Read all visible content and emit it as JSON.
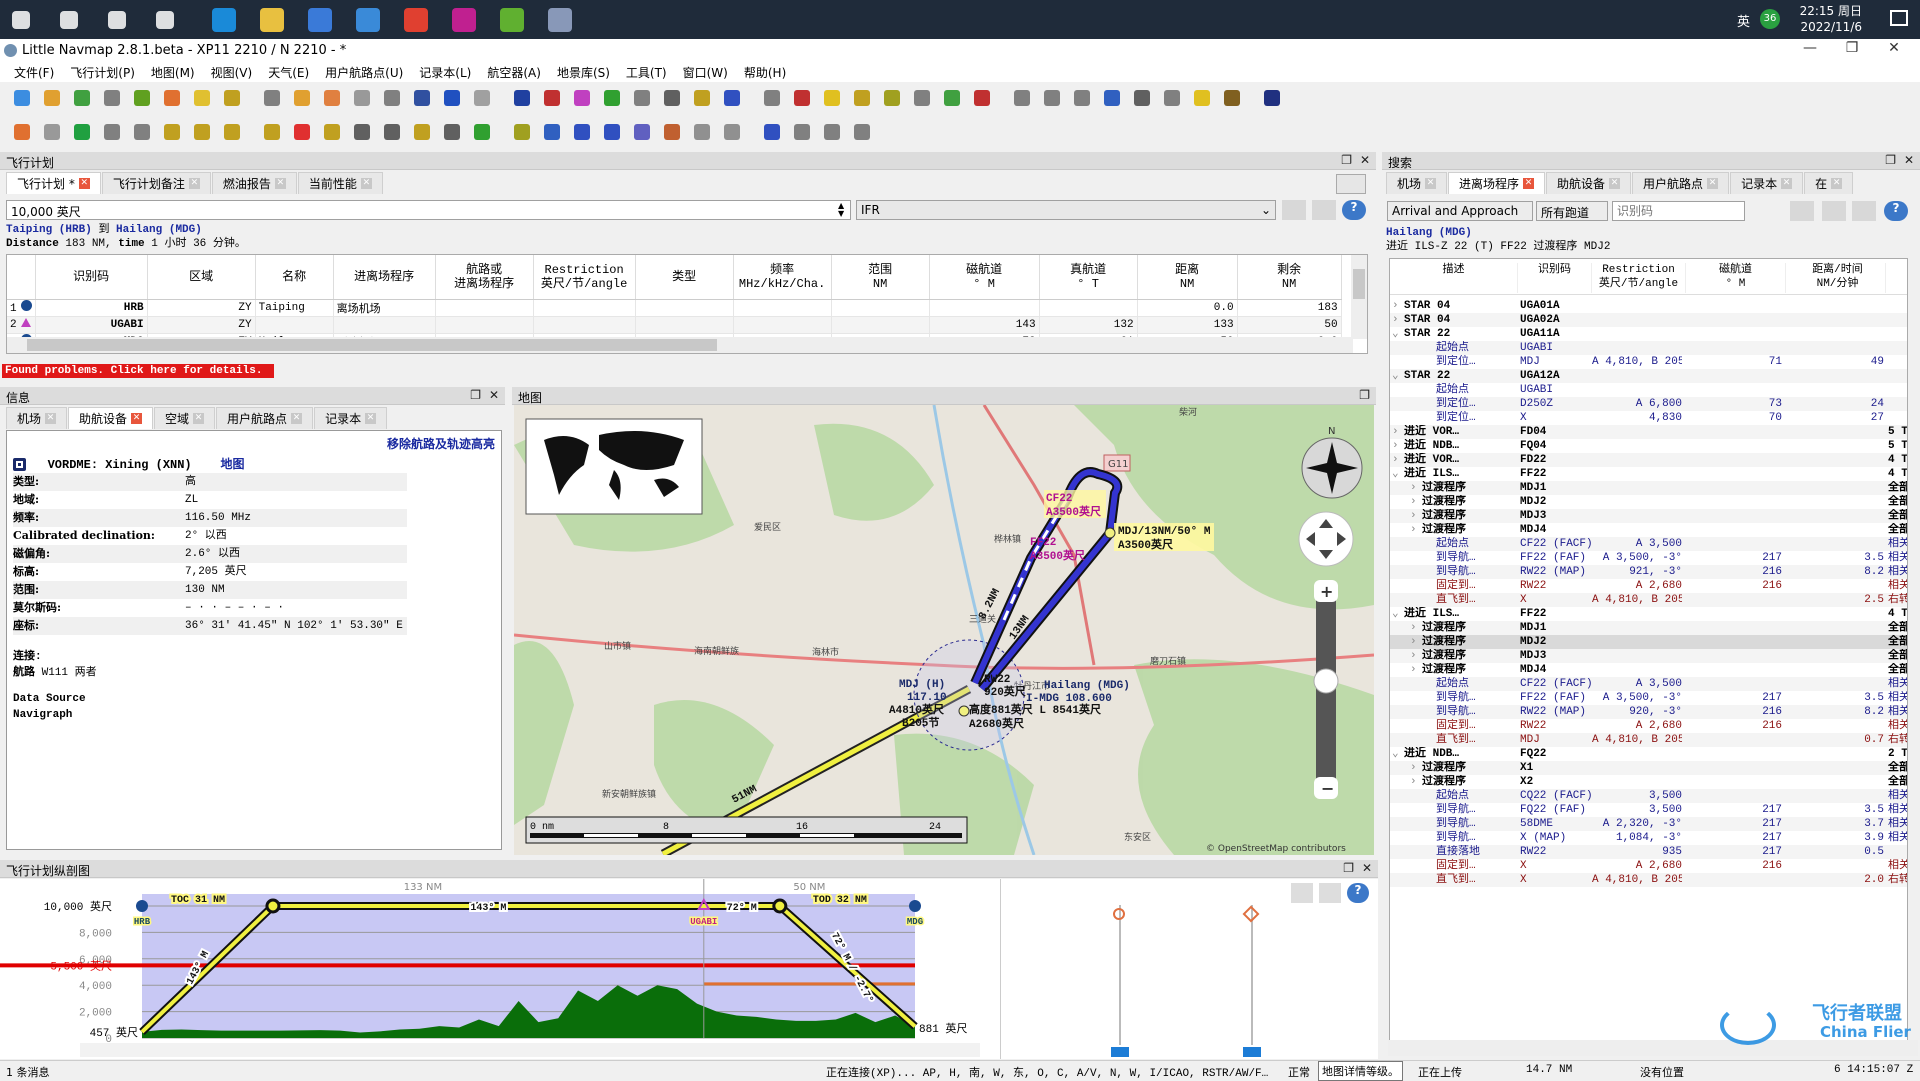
{
  "taskbar": {
    "tray_lang": "英",
    "tray_badge": "36",
    "time": "22:15 周日",
    "date": "2022/11/6",
    "apps": [
      "start-icon",
      "search-icon",
      "cortana-icon",
      "taskview-icon",
      "edge-icon",
      "explorer-icon",
      "store-icon",
      "mail-icon",
      "chrome-icon",
      "app-icon",
      "app-green-icon",
      "littlenavmap-icon"
    ]
  },
  "window": {
    "title": "Little Navmap 2.8.1.beta - XP11 2210 / N 2210 - *"
  },
  "menu": [
    "文件(F)",
    "飞行计划(P)",
    "地图(M)",
    "视图(V)",
    "天气(E)",
    "用户航路点(U)",
    "记录本(L)",
    "航空器(A)",
    "地景库(S)",
    "工具(T)",
    "窗口(W)",
    "帮助(H)"
  ],
  "toolbar": {
    "row1": [
      [
        "new-icon",
        "#3c8de0"
      ],
      [
        "open-icon",
        "#e0a030"
      ],
      [
        "save-icon",
        "#40a040"
      ],
      [
        "save-as-icon",
        "#808080"
      ],
      [
        "reload-icon",
        "#60a020"
      ],
      [
        "home-icon",
        "#e07030"
      ],
      [
        "add-icon",
        "#e0c030"
      ],
      [
        "route-icon",
        "#c0a020"
      ],
      [
        "clear-icon",
        "#808080"
      ],
      [
        "upload-icon",
        "#e0a030"
      ],
      [
        "back-icon",
        "#e08040"
      ],
      [
        "forward-icon",
        "#999999"
      ],
      [
        "search-map-icon",
        "#808080"
      ],
      [
        "globe-icon",
        "#3050a0"
      ],
      [
        "vor-icon",
        "#2050c0"
      ],
      [
        "ndb-icon",
        "#a0a0a0"
      ],
      [
        "ils-icon",
        "#2040a0"
      ],
      [
        "weather-icon",
        "#c03030"
      ],
      [
        "waypoint-icon",
        "#c040c0"
      ],
      [
        "airway-icon",
        "#30a030"
      ],
      [
        "pencil-icon",
        "#808080"
      ],
      [
        "compass-icon",
        "#606060"
      ],
      [
        "v-icon",
        "#c0a020"
      ],
      [
        "j-icon",
        "#3050c0"
      ],
      [
        "t-icon",
        "#808080"
      ],
      [
        "target-icon",
        "#c03030"
      ],
      [
        "star-icon",
        "#e0c020"
      ],
      [
        "route-line-icon",
        "#c0a020"
      ],
      [
        "leaf-icon",
        "#a0a020"
      ],
      [
        "aircraft-icon",
        "#808080"
      ],
      [
        "aircraft-green-icon",
        "#40a040"
      ],
      [
        "compass-red-icon",
        "#c03030"
      ],
      [
        "plane-icon",
        "#808080"
      ],
      [
        "plane2-icon",
        "#808080"
      ],
      [
        "plane3-icon",
        "#808080"
      ],
      [
        "grid-icon",
        "#3060c0"
      ],
      [
        "circle-icon",
        "#606060"
      ],
      [
        "calc-icon",
        "#808080"
      ],
      [
        "sun-icon",
        "#e0c020"
      ],
      [
        "wind-icon",
        "#806020"
      ],
      [
        "sphere-icon",
        "#203080"
      ]
    ],
    "row2": [
      [
        "undo-icon",
        "#e07030"
      ],
      [
        "redo-icon",
        "#999999"
      ],
      [
        "go-icon",
        "#20a040"
      ],
      [
        "edit-icon",
        "#808080"
      ],
      [
        "edit2-icon",
        "#808080"
      ],
      [
        "select-icon",
        "#c0a020"
      ],
      [
        "add-wp-icon",
        "#c0a020"
      ],
      [
        "move-icon",
        "#c0a020"
      ],
      [
        "move2-icon",
        "#c0a020"
      ],
      [
        "delete-icon",
        "#e03030"
      ],
      [
        "pin-icon",
        "#c0a020"
      ],
      [
        "fit-icon",
        "#606060"
      ],
      [
        "zoom-icon",
        "#606060"
      ],
      [
        "route-fit-icon",
        "#c0a020"
      ],
      [
        "italic-icon",
        "#606060"
      ],
      [
        "terrain-icon",
        "#30a030"
      ],
      [
        "map-icon",
        "#a0a020"
      ],
      [
        "help-map-icon",
        "#3060c0"
      ],
      [
        "nav1-icon",
        "#3050c0"
      ],
      [
        "nav2-icon",
        "#3050c0"
      ],
      [
        "nav3-icon",
        "#6060c0"
      ],
      [
        "nav4-icon",
        "#c06030"
      ],
      [
        "nav5-icon",
        "#909090"
      ],
      [
        "nav6-icon",
        "#909090"
      ],
      [
        "nav7-icon",
        "#3050c0"
      ],
      [
        "doc-icon",
        "#808080"
      ],
      [
        "db-icon",
        "#808080"
      ],
      [
        "gear-icon",
        "#808080"
      ]
    ]
  },
  "flightplan": {
    "dock_title": "飞行计划",
    "tabs": [
      "飞行计划 *",
      "飞行计划备注",
      "燃油报告",
      "当前性能"
    ],
    "altitude": "10,000 英尺",
    "type": "IFR",
    "from": "Taiping (HRB)",
    "to_word": "到",
    "to": "Hailang (MDG)",
    "distance_label": "Distance",
    "distance": "183 NM,",
    "time_label": "time",
    "time": "1 小时 36 分钟。",
    "columns": [
      "",
      "识别码",
      "区域",
      "名称",
      "进离场程序",
      "航路或\n进离场程序",
      "Restriction\n英尺/节/angle",
      "类型",
      "频率\nMHz/kHz/Cha.",
      "范围\nNM",
      "磁航道\n° M",
      "真航道\n° T",
      "距离\nNM",
      "剩余\nNM"
    ],
    "rows": [
      [
        "1",
        "HRB",
        "ZY",
        "Taiping",
        "离场机场",
        "",
        "",
        "",
        "",
        "",
        "",
        "",
        "0.0",
        "183"
      ],
      [
        "2",
        "UGABI",
        "ZY",
        "",
        "",
        "",
        "",
        "",
        "",
        "",
        "143",
        "132",
        "133",
        "50"
      ],
      [
        "3",
        "MDG",
        "ZY",
        "Hailang",
        "到达机场",
        "",
        "",
        "",
        "",
        "",
        "72",
        "61",
        "50",
        "0.0"
      ]
    ],
    "row_icons": [
      "airport-icon",
      "waypoint-icon",
      "airport-icon"
    ],
    "problem": "Found problems. Click here for details."
  },
  "info": {
    "dock_title": "信息",
    "tabs": [
      "机场",
      "助航设备",
      "空域",
      "用户航路点",
      "记录本"
    ],
    "remove_link": "移除航路及轨迹高亮",
    "title": "VORDME: Xining (XNN)",
    "map_link": "地图",
    "rows": [
      [
        "类型:",
        "高"
      ],
      [
        "地域:",
        "ZL"
      ],
      [
        "频率:",
        "116.50 MHz"
      ],
      [
        "Calibrated declination:",
        "2° 以西"
      ],
      [
        "磁偏角:",
        "2.6° 以西"
      ],
      [
        "标高:",
        "7,205 英尺"
      ],
      [
        "范围:",
        "130 NM"
      ],
      [
        "莫尔斯码:",
        "– · · –   – ·   – ·"
      ],
      [
        "座标:",
        "36° 31′ 41.45″ N 102° 1′ 53.30″ E"
      ]
    ],
    "connections_label": "连接:",
    "airway_label": "航路",
    "airway_value": "W111 两者",
    "source_label": "Data Source",
    "source_value": "Navigraph"
  },
  "map": {
    "dock_title": "地图",
    "towns": [
      [
        "柴河",
        "665",
        "-2"
      ],
      [
        "爱民区",
        "240",
        "113"
      ],
      [
        "桦林镇",
        "480",
        "125"
      ],
      [
        "三道关",
        "455",
        "205"
      ],
      [
        "海林市",
        "298",
        "238"
      ],
      [
        "海南朝鲜族",
        "180",
        "237"
      ],
      [
        "山市镇",
        "90",
        "232"
      ],
      [
        "牡丹江市",
        "500",
        "272"
      ],
      [
        "磨刀石镇",
        "636",
        "247"
      ],
      [
        "新安朝鲜族镇",
        "88",
        "380"
      ],
      [
        "温春镇",
        "380",
        "412"
      ],
      [
        "东安区",
        "610",
        "423"
      ]
    ],
    "road": "G11",
    "labels": {
      "cf22": "CF22",
      "cf22_alt": "A3500英尺",
      "ff22": "FF22",
      "ff22_alt": "A3500英尺",
      "mdj13": "MDJ/13NM/50° M",
      "mdj13_alt": "A3500英尺",
      "rw22": "RW22",
      "rw22_alt": "920英尺",
      "mdg": "Hailang (MDG)",
      "freq": "I-MDG 108.600",
      "mdj": "MDJ (H)",
      "mdj_freq": "117.10",
      "mdj_alt": "A4810英尺",
      "mdj_spd": "B205节",
      "alt2680": "A2680英尺",
      "elev": "高度881英尺 L 8541英尺",
      "leg1": "8.2NM",
      "leg2": "13NM",
      "leg3": "51NM"
    },
    "scale": [
      "0 nm",
      "8",
      "16",
      "24"
    ],
    "attribution": "© OpenStreetMap contributors",
    "compass_n": "N"
  },
  "search": {
    "dock_title": "搜索",
    "tabs": [
      "机场",
      "进离场程序",
      "助航设备",
      "用户航路点",
      "记录本",
      "在"
    ],
    "filter": "Arrival and Approach",
    "runway": "所有跑道",
    "ident_placeholder": "识别码",
    "airport": "Hailang (MDG)",
    "selected": "进近 ILS-Z 22 (T) FF22 过渡程序 MDJ2",
    "columns": [
      "描述",
      "识别码",
      "Restriction\n英尺/节/angle",
      "磁航道\n° M",
      "距离/时间\nNM/分钟",
      ""
    ],
    "rows": [
      [
        "g",
        "c",
        "STAR 04",
        "UGA01A",
        "",
        "",
        "",
        ""
      ],
      [
        "g",
        "c",
        "STAR 04",
        "UGA02A",
        "",
        "",
        "",
        ""
      ],
      [
        "g",
        "e",
        "STAR 22",
        "UGA11A",
        "",
        "",
        "",
        ""
      ],
      [
        "l",
        "",
        "起始点",
        "UGABI",
        "",
        "",
        "",
        ""
      ],
      [
        "l",
        "",
        "到定位…",
        "MDJ",
        "A 4,810, B 205",
        "71",
        "49",
        ""
      ],
      [
        "g",
        "e",
        "STAR 22",
        "UGA12A",
        "",
        "",
        "",
        ""
      ],
      [
        "l",
        "",
        "起始点",
        "UGABI",
        "",
        "",
        "",
        ""
      ],
      [
        "l",
        "",
        "到定位…",
        "D250Z",
        "A 6,800",
        "73",
        "24",
        ""
      ],
      [
        "l",
        "",
        "到定位…",
        "X",
        "4,830",
        "70",
        "27",
        ""
      ],
      [
        "g",
        "c",
        "进近 VOR…",
        "FD04",
        "",
        "",
        "",
        "5 T"
      ],
      [
        "g",
        "c",
        "进近 NDB…",
        "FQ04",
        "",
        "",
        "",
        "5 T"
      ],
      [
        "g",
        "c",
        "进近 VOR…",
        "FD22",
        "",
        "",
        "",
        "4 T"
      ],
      [
        "g",
        "e",
        "进近 ILS…",
        "FF22",
        "",
        "",
        "",
        "4 T"
      ],
      [
        "t",
        "c",
        "过渡程序",
        "MDJ1",
        "",
        "",
        "",
        "全部"
      ],
      [
        "t",
        "c",
        "过渡程序",
        "MDJ2",
        "",
        "",
        "",
        "全部"
      ],
      [
        "t",
        "c",
        "过渡程序",
        "MDJ3",
        "",
        "",
        "",
        "全部"
      ],
      [
        "t",
        "c",
        "过渡程序",
        "MDJ4",
        "",
        "",
        "",
        "全部"
      ],
      [
        "l",
        "",
        "起始点",
        "CF22 (FACF)",
        "A 3,500",
        "",
        "",
        "相关"
      ],
      [
        "l",
        "",
        "到导航…",
        "FF22 (FAF)",
        "A 3,500, -3°",
        "217",
        "3.5",
        "相关"
      ],
      [
        "l",
        "",
        "到导航…",
        "RW22 (MAP)",
        "921, -3°",
        "216",
        "8.2",
        "相关"
      ],
      [
        "m",
        "",
        "固定到…",
        "RW22",
        "A 2,680",
        "216",
        "",
        "相关"
      ],
      [
        "m",
        "",
        "直飞到…",
        "X",
        "A 4,810, B 205",
        "",
        "2.5",
        "右转"
      ],
      [
        "g",
        "e",
        "进近 ILS…",
        "FF22",
        "",
        "",
        "",
        "4 T"
      ],
      [
        "t",
        "c",
        "过渡程序",
        "MDJ1",
        "",
        "",
        "",
        "全部"
      ],
      [
        "s",
        "c",
        "过渡程序",
        "MDJ2",
        "",
        "",
        "",
        "全部"
      ],
      [
        "t",
        "c",
        "过渡程序",
        "MDJ3",
        "",
        "",
        "",
        "全部"
      ],
      [
        "t",
        "c",
        "过渡程序",
        "MDJ4",
        "",
        "",
        "",
        "全部"
      ],
      [
        "l",
        "",
        "起始点",
        "CF22 (FACF)",
        "A 3,500",
        "",
        "",
        "相关"
      ],
      [
        "l",
        "",
        "到导航…",
        "FF22 (FAF)",
        "A 3,500, -3°",
        "217",
        "3.5",
        "相关"
      ],
      [
        "l",
        "",
        "到导航…",
        "RW22 (MAP)",
        "920, -3°",
        "216",
        "8.2",
        "相关"
      ],
      [
        "m",
        "",
        "固定到…",
        "RW22",
        "A 2,680",
        "216",
        "",
        "相关"
      ],
      [
        "m",
        "",
        "直飞到…",
        "MDJ",
        "A 4,810, B 205",
        "",
        "0.7",
        "右转"
      ],
      [
        "g",
        "e",
        "进近 NDB…",
        "FQ22",
        "",
        "",
        "",
        "2 T"
      ],
      [
        "t",
        "c",
        "过渡程序",
        "X1",
        "",
        "",
        "",
        "全部"
      ],
      [
        "t",
        "c",
        "过渡程序",
        "X2",
        "",
        "",
        "",
        "全部"
      ],
      [
        "l",
        "",
        "起始点",
        "CQ22 (FACF)",
        "3,500",
        "",
        "",
        "相关"
      ],
      [
        "l",
        "",
        "到导航…",
        "FQ22 (FAF)",
        "3,500",
        "217",
        "3.5",
        "相关"
      ],
      [
        "l",
        "",
        "到导航…",
        "58DME",
        "A 2,320, -3°",
        "217",
        "3.7",
        "相关"
      ],
      [
        "l",
        "",
        "到导航…",
        "X (MAP)",
        "1,084, -3°",
        "217",
        "3.9",
        "相关"
      ],
      [
        "l",
        "",
        "直接落地",
        "RW22",
        "935",
        "217",
        "0.5",
        ""
      ],
      [
        "m",
        "",
        "固定到…",
        "X",
        "A 2,680",
        "216",
        "",
        "相关"
      ],
      [
        "m",
        "",
        "直飞到…",
        "X",
        "A 4,810, B 205",
        "",
        "2.0",
        "右转"
      ]
    ]
  },
  "profile": {
    "dock_title": "飞行计划纵剖图",
    "y_ticks": [
      [
        "10,000 英尺",
        10000
      ],
      [
        "8,000",
        8000
      ],
      [
        "6,000",
        6000
      ],
      [
        "4,000",
        4000
      ],
      [
        "2,000",
        2000
      ],
      [
        "0",
        0
      ]
    ],
    "safe_alt_label": "5,500 英尺",
    "safe_alt": 5500,
    "leg_safe_alt": 4100,
    "leg_labels": [
      "133 NM",
      "50 NM"
    ],
    "waypoints": [
      [
        "HRB",
        0
      ],
      [
        "UGABI",
        133
      ],
      [
        "MDG",
        183
      ]
    ],
    "toc": "TOC 31 NM",
    "toc_nm": 31,
    "tod": "TOD 32 NM",
    "tod_nm": 151,
    "cruise_alt": 10000,
    "dep_elev": 457,
    "arr_elev": 881,
    "dep_label": "457 英尺",
    "arr_label": "881 英尺",
    "climb_label": "143° M",
    "cruise1_label": "143° M",
    "cruise2_label": "72° M",
    "descent_label": "72° M / -2.7°",
    "terrain_ft": [
      460,
      620,
      640,
      600,
      560,
      560,
      560,
      560,
      580,
      600,
      560,
      420,
      500,
      640,
      700,
      900,
      800,
      1400,
      900,
      2800,
      1200,
      1500,
      3600,
      2800,
      4000,
      3200,
      4000,
      3700,
      2600,
      2000,
      1700,
      1600,
      1400,
      1300,
      1300,
      1400,
      1900,
      1200,
      1700,
      900
    ],
    "colors": {
      "plot_bg": "#c8c8f4",
      "terrain": "#0a6e0a",
      "route": "#f0f040",
      "safe": "#e00000",
      "leg_safe": "#e07030"
    }
  },
  "status": {
    "messages": "1 条消息",
    "connect": "正在连接(XP)... AP, H, 南, W, 东, O, C, A/V, N, W, I/ICAO, RSTR/AW/F…",
    "mode": "正常",
    "tooltip": "地图详情等级。",
    "upload": "正在上传",
    "dist": "14.7 NM",
    "position": "没有位置",
    "clock": "6  14:15:07 Z"
  },
  "watermark": {
    "cn": "飞行者联盟",
    "en": "China Flier"
  }
}
